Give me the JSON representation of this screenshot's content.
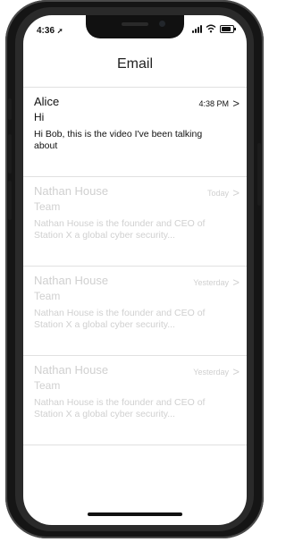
{
  "status_bar": {
    "time": "4:36",
    "battery_level": 0.85
  },
  "nav": {
    "title": "Email"
  },
  "emails": [
    {
      "sender": "Alice",
      "subject": "Hi",
      "preview": "Hi Bob, this is the video I've been talking about",
      "time": "4:38 PM",
      "faded": false
    },
    {
      "sender": "Nathan House",
      "subject": "Team",
      "preview": "Nathan House is the founder and CEO of Station X a global cyber security...",
      "time": "Today",
      "faded": true
    },
    {
      "sender": "Nathan House",
      "subject": "Team",
      "preview": "Nathan House is the founder and CEO of Station X a global cyber security...",
      "time": "Yesterday",
      "faded": true
    },
    {
      "sender": "Nathan House",
      "subject": "Team",
      "preview": "Nathan House is the founder and CEO of Station X a global cyber security...",
      "time": "Yesterday",
      "faded": true
    }
  ],
  "icons": {
    "chevron": "chevron-right-icon",
    "location": "location-arrow-icon",
    "signal": "signal-icon",
    "wifi": "wifi-icon",
    "battery": "battery-icon"
  }
}
